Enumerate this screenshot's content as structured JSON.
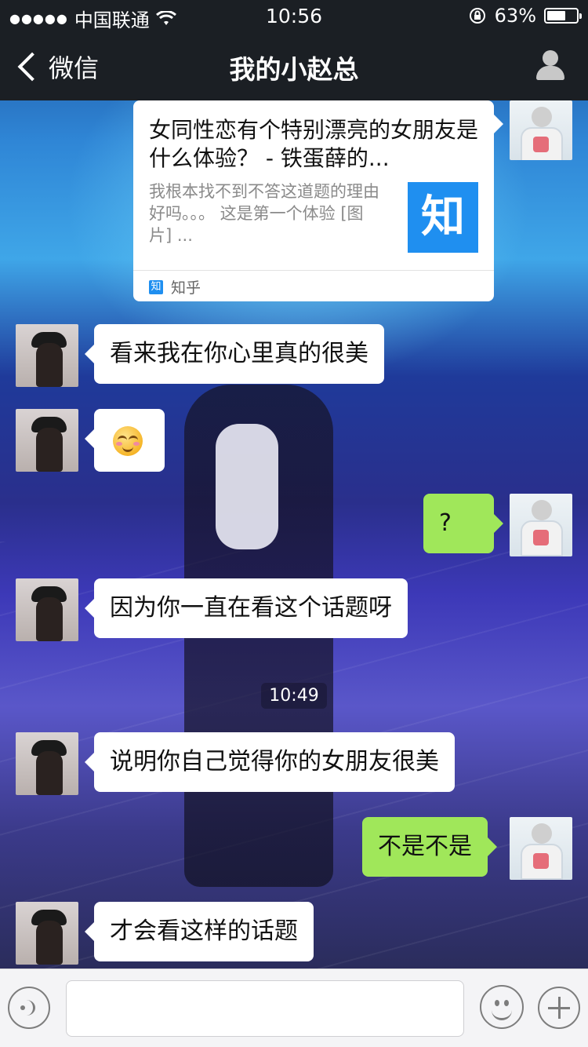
{
  "status_bar": {
    "signal": "●●●●●",
    "carrier": "中国联通",
    "time": "10:56",
    "battery_text": "63%",
    "battery_level": 0.63
  },
  "nav": {
    "back_label": "微信",
    "title": "我的小赵总"
  },
  "card": {
    "title": "女同性恋有个特别漂亮的女朋友是什么体验？ - 铁蛋薛的...",
    "description": "我根本找不到不答这道题的理由好吗。。。 这是第一个体验 [图片] ...",
    "thumb_text": "知",
    "source_badge": "知",
    "source_name": "知乎"
  },
  "messages": [
    {
      "side": "left",
      "text": "看来我在你心里真的很美"
    },
    {
      "side": "left",
      "emoji": "smirk-emoji"
    },
    {
      "side": "right",
      "text": "?"
    },
    {
      "side": "left",
      "text": "因为你一直在看这个话题呀"
    },
    {
      "side": "left",
      "text": "说明你自己觉得你的女朋友很美"
    },
    {
      "side": "right",
      "text": "不是不是"
    },
    {
      "side": "left",
      "text": "才会看这样的话题"
    }
  ],
  "timestamp": "10:49",
  "colors": {
    "bar_bg": "#1b1f24",
    "bubble_self": "#a0e75a",
    "bubble_other": "#ffffff",
    "zhihu_blue": "#1f8ff0"
  }
}
